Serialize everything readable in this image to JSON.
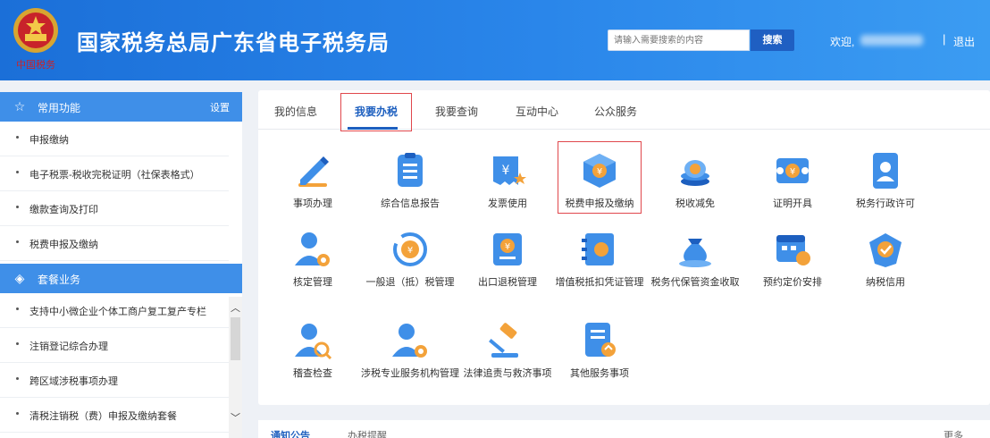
{
  "header": {
    "brand_script": "中国税务",
    "title": "国家税务总局广东省电子税务局",
    "search_placeholder": "请输入需要搜索的内容",
    "search_button": "搜索",
    "welcome": "欢迎,",
    "separator": "|",
    "logout": "退出"
  },
  "sidebar": {
    "common": {
      "title": "常用功能",
      "setting": "设置",
      "icon": "star-icon"
    },
    "common_items": [
      "申报缴纳",
      "电子税票-税收完税证明（社保表格式）",
      "缴款查询及打印",
      "税费申报及缴纳"
    ],
    "hot": {
      "title": "套餐业务",
      "icon": "cube-icon"
    },
    "hot_items": [
      "支持中小微企业个体工商户复工复产专栏",
      "注销登记综合办理",
      "跨区域涉税事项办理",
      "清税注销税（费）申报及缴纳套餐"
    ]
  },
  "tabs": [
    "我的信息",
    "我要办税",
    "我要查询",
    "互动中心",
    "公众服务"
  ],
  "active_tab": "我要办税",
  "tiles": [
    {
      "label": "事项办理",
      "icon": "pen-icon"
    },
    {
      "label": "综合信息报告",
      "icon": "report-icon"
    },
    {
      "label": "发票使用",
      "icon": "invoice-icon"
    },
    {
      "label": "税费申报及缴纳",
      "icon": "tax-declare-icon"
    },
    {
      "label": "税收减免",
      "icon": "coins-icon"
    },
    {
      "label": "证明开具",
      "icon": "certificate-icon"
    },
    {
      "label": "税务行政许可",
      "icon": "license-icon"
    },
    {
      "label": "核定管理",
      "icon": "user-gear-icon"
    },
    {
      "label": "一般退（抵）税管理",
      "icon": "refund-icon"
    },
    {
      "label": "出口退税管理",
      "icon": "export-icon"
    },
    {
      "label": "增值税抵扣凭证管理",
      "icon": "voucher-icon"
    },
    {
      "label": "税务代保管资金收取",
      "icon": "money-bag-icon"
    },
    {
      "label": "预约定价安排",
      "icon": "calendar-icon"
    },
    {
      "label": "纳税信用",
      "icon": "credit-icon"
    },
    {
      "label": "稽查检查",
      "icon": "inspect-icon"
    },
    {
      "label": "涉税专业服务机构管理",
      "icon": "agency-icon"
    },
    {
      "label": "法律追责与救济事项",
      "icon": "gavel-icon"
    },
    {
      "label": "其他服务事项",
      "icon": "other-services-icon"
    }
  ],
  "bottom": {
    "title": "通知公告",
    "tab2": "办税提醒",
    "more": "更多"
  },
  "colors": {
    "header": "#2a86ea",
    "accent": "#1d5fbf",
    "sidebar_head": "#3f8fe8",
    "highlight": "#e0474c"
  }
}
